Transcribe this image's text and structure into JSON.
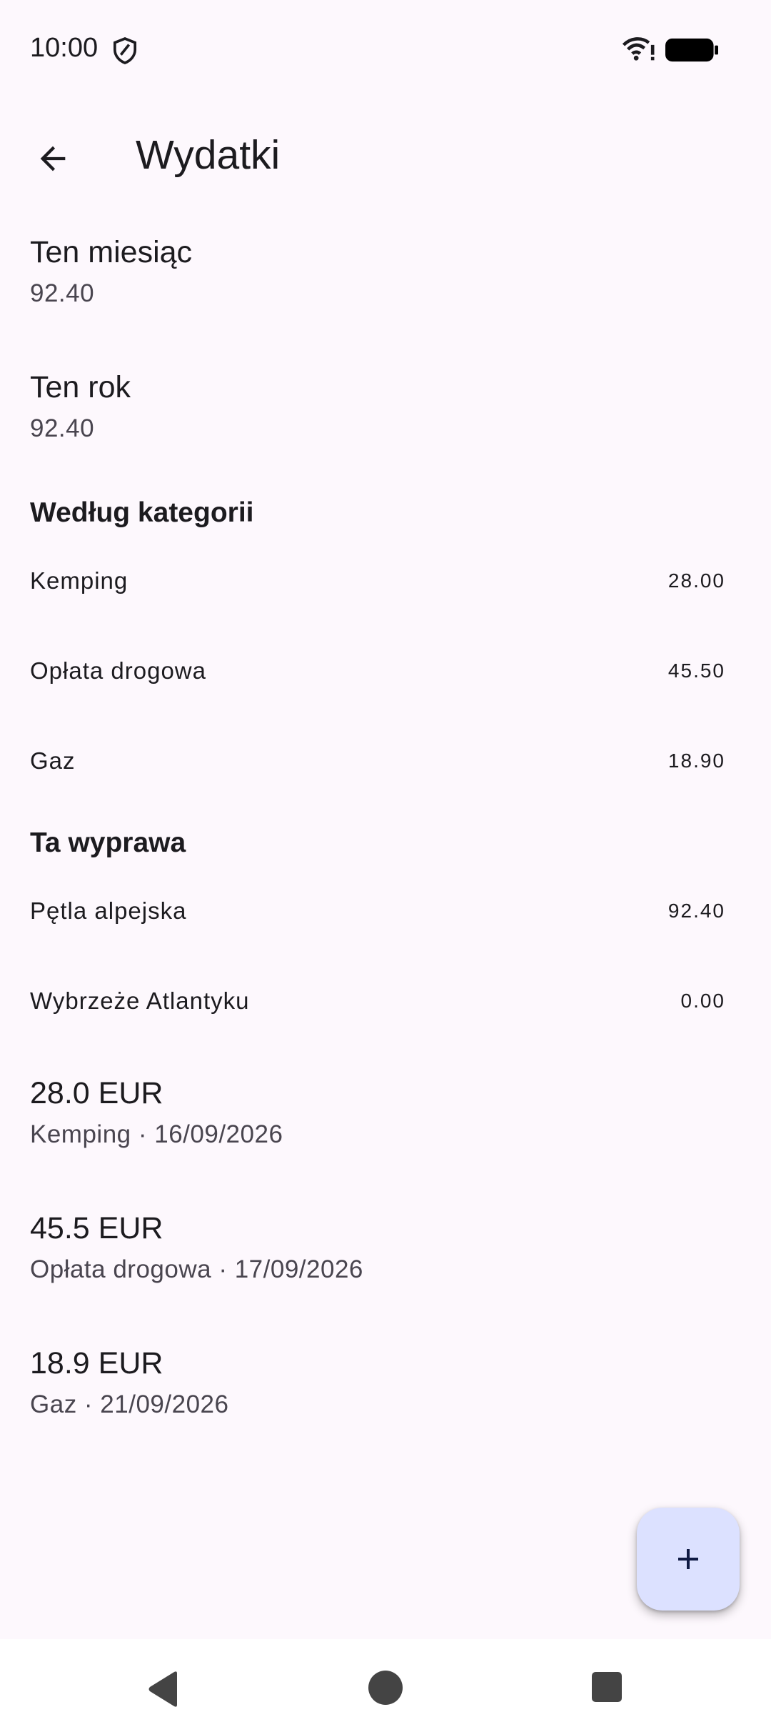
{
  "status_bar": {
    "time": "10:00",
    "icons": [
      "shield-icon",
      "wifi-icon",
      "battery-icon"
    ]
  },
  "app_bar": {
    "title": "Wydatki",
    "back_icon": "arrow-back-icon"
  },
  "summary": {
    "month": {
      "label": "Ten miesiąc",
      "value": "92.40"
    },
    "year": {
      "label": "Ten rok",
      "value": "92.40"
    }
  },
  "by_category": {
    "header": "Według kategorii",
    "items": [
      {
        "label": "Kemping",
        "value": "28.00"
      },
      {
        "label": "Opłata drogowa",
        "value": "45.50"
      },
      {
        "label": "Gaz",
        "value": "18.90"
      }
    ]
  },
  "this_trip": {
    "header": "Ta wyprawa",
    "items": [
      {
        "label": "Pętla alpejska",
        "value": "92.40"
      },
      {
        "label": "Wybrzeże Atlantyku",
        "value": "0.00"
      }
    ]
  },
  "expenses": [
    {
      "amount": "28.0 EUR",
      "meta": "Kemping · 16/09/2026"
    },
    {
      "amount": "45.5 EUR",
      "meta": "Opłata drogowa · 17/09/2026"
    },
    {
      "amount": "18.9 EUR",
      "meta": "Gaz · 21/09/2026"
    }
  ],
  "fab": {
    "icon": "plus-icon"
  },
  "nav_bar": {
    "icons": [
      "nav-back-icon",
      "nav-home-icon",
      "nav-recents-icon"
    ]
  },
  "colors": {
    "background": "#fdf8fd",
    "fab": "#dce1ff",
    "text": "#1c1b1f",
    "secondary_text": "#49454f"
  }
}
